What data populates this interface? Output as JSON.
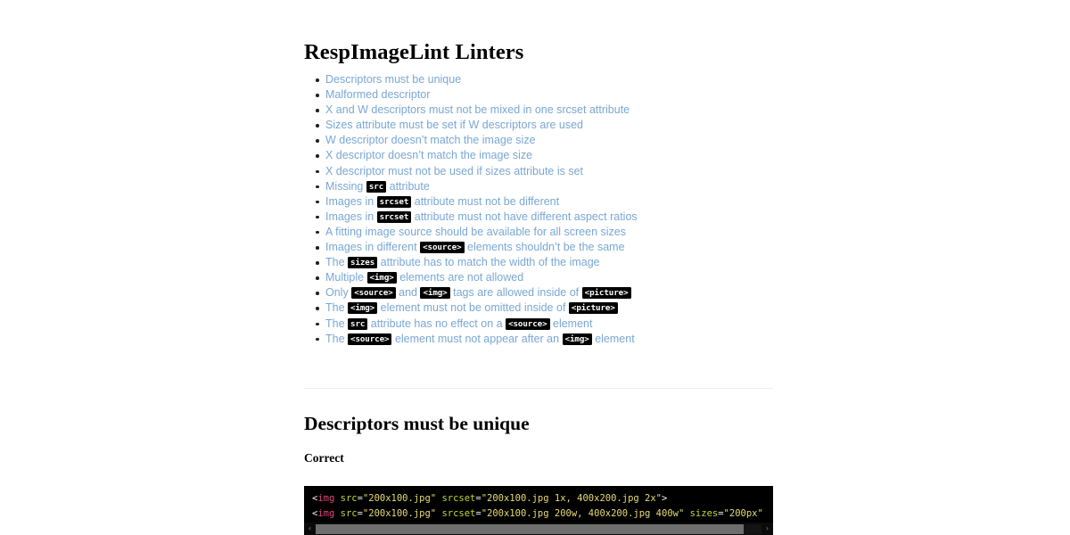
{
  "page": {
    "title": "RespImageLint Linters"
  },
  "linters": [
    {
      "parts": [
        {
          "t": "text",
          "v": "Descriptors must be unique"
        }
      ]
    },
    {
      "parts": [
        {
          "t": "text",
          "v": "Malformed descriptor"
        }
      ]
    },
    {
      "parts": [
        {
          "t": "text",
          "v": "X and W descriptors must not be mixed in one srcset attribute"
        }
      ]
    },
    {
      "parts": [
        {
          "t": "text",
          "v": "Sizes attribute must be set if W descriptors are used"
        }
      ]
    },
    {
      "parts": [
        {
          "t": "text",
          "v": "W descriptor doesn’t match the image size"
        }
      ]
    },
    {
      "parts": [
        {
          "t": "text",
          "v": "X descriptor doesn’t match the image size"
        }
      ]
    },
    {
      "parts": [
        {
          "t": "text",
          "v": "X descriptor must not be used if sizes attribute is set"
        }
      ]
    },
    {
      "parts": [
        {
          "t": "text",
          "v": "Missing "
        },
        {
          "t": "code",
          "v": "src"
        },
        {
          "t": "text",
          "v": " attribute"
        }
      ]
    },
    {
      "parts": [
        {
          "t": "text",
          "v": "Images in "
        },
        {
          "t": "code",
          "v": "srcset"
        },
        {
          "t": "text",
          "v": " attribute must not be different"
        }
      ]
    },
    {
      "parts": [
        {
          "t": "text",
          "v": "Images in "
        },
        {
          "t": "code",
          "v": "srcset"
        },
        {
          "t": "text",
          "v": " attribute must not have different aspect ratios"
        }
      ]
    },
    {
      "parts": [
        {
          "t": "text",
          "v": "A fitting image source should be available for all screen sizes"
        }
      ]
    },
    {
      "parts": [
        {
          "t": "text",
          "v": "Images in different "
        },
        {
          "t": "code",
          "v": "<source>"
        },
        {
          "t": "text",
          "v": " elements shouldn’t be the same"
        }
      ]
    },
    {
      "parts": [
        {
          "t": "text",
          "v": "The "
        },
        {
          "t": "code",
          "v": "sizes"
        },
        {
          "t": "text",
          "v": " attribute has to match the width of the image"
        }
      ]
    },
    {
      "parts": [
        {
          "t": "text",
          "v": "Multiple "
        },
        {
          "t": "code",
          "v": "<img>"
        },
        {
          "t": "text",
          "v": " elements are not allowed"
        }
      ]
    },
    {
      "parts": [
        {
          "t": "text",
          "v": "Only "
        },
        {
          "t": "code",
          "v": "<source>"
        },
        {
          "t": "text",
          "v": " and "
        },
        {
          "t": "code",
          "v": "<img>"
        },
        {
          "t": "text",
          "v": " tags are allowed inside of "
        },
        {
          "t": "code",
          "v": "<picture>"
        }
      ]
    },
    {
      "parts": [
        {
          "t": "text",
          "v": "The "
        },
        {
          "t": "code",
          "v": "<img>"
        },
        {
          "t": "text",
          "v": " element must not be omitted inside of "
        },
        {
          "t": "code",
          "v": "<picture>"
        }
      ]
    },
    {
      "parts": [
        {
          "t": "text",
          "v": "The "
        },
        {
          "t": "code",
          "v": "src"
        },
        {
          "t": "text",
          "v": " attribute has no effect on a "
        },
        {
          "t": "code",
          "v": "<source>"
        },
        {
          "t": "text",
          "v": " element"
        }
      ]
    },
    {
      "parts": [
        {
          "t": "text",
          "v": "The "
        },
        {
          "t": "code",
          "v": "<source>"
        },
        {
          "t": "text",
          "v": " element must not appear after an "
        },
        {
          "t": "code",
          "v": "<img>"
        },
        {
          "t": "text",
          "v": " element"
        }
      ]
    }
  ],
  "section": {
    "heading": "Descriptors must be unique",
    "subheading": "Correct"
  },
  "code_block": {
    "lines": [
      [
        {
          "t": "punct",
          "v": "<"
        },
        {
          "t": "tag",
          "v": "img"
        },
        {
          "t": "punct",
          "v": " "
        },
        {
          "t": "attr",
          "v": "src"
        },
        {
          "t": "punct",
          "v": "="
        },
        {
          "t": "str",
          "v": "\"200x100.jpg\""
        },
        {
          "t": "punct",
          "v": " "
        },
        {
          "t": "attr",
          "v": "srcset"
        },
        {
          "t": "punct",
          "v": "="
        },
        {
          "t": "str",
          "v": "\"200x100.jpg 1x, 400x200.jpg 2x\""
        },
        {
          "t": "punct",
          "v": ">"
        }
      ],
      [
        {
          "t": "punct",
          "v": "<"
        },
        {
          "t": "tag",
          "v": "img"
        },
        {
          "t": "punct",
          "v": " "
        },
        {
          "t": "attr",
          "v": "src"
        },
        {
          "t": "punct",
          "v": "="
        },
        {
          "t": "str",
          "v": "\"200x100.jpg\""
        },
        {
          "t": "punct",
          "v": " "
        },
        {
          "t": "attr",
          "v": "srcset"
        },
        {
          "t": "punct",
          "v": "="
        },
        {
          "t": "str",
          "v": "\"200x100.jpg 200w, 400x200.jpg 400w\""
        },
        {
          "t": "punct",
          "v": " "
        },
        {
          "t": "attr",
          "v": "sizes"
        },
        {
          "t": "punct",
          "v": "="
        },
        {
          "t": "str",
          "v": "\"200px\""
        }
      ]
    ],
    "scroll_left_arrow": "‹",
    "scroll_right_arrow": "›"
  },
  "colors": {
    "link": "#7aa7d4",
    "code_bg": "#000000",
    "code_tag": "#e0457b",
    "code_attr": "#c3d82c",
    "code_string": "#e6db74",
    "divider": "#ededed"
  }
}
